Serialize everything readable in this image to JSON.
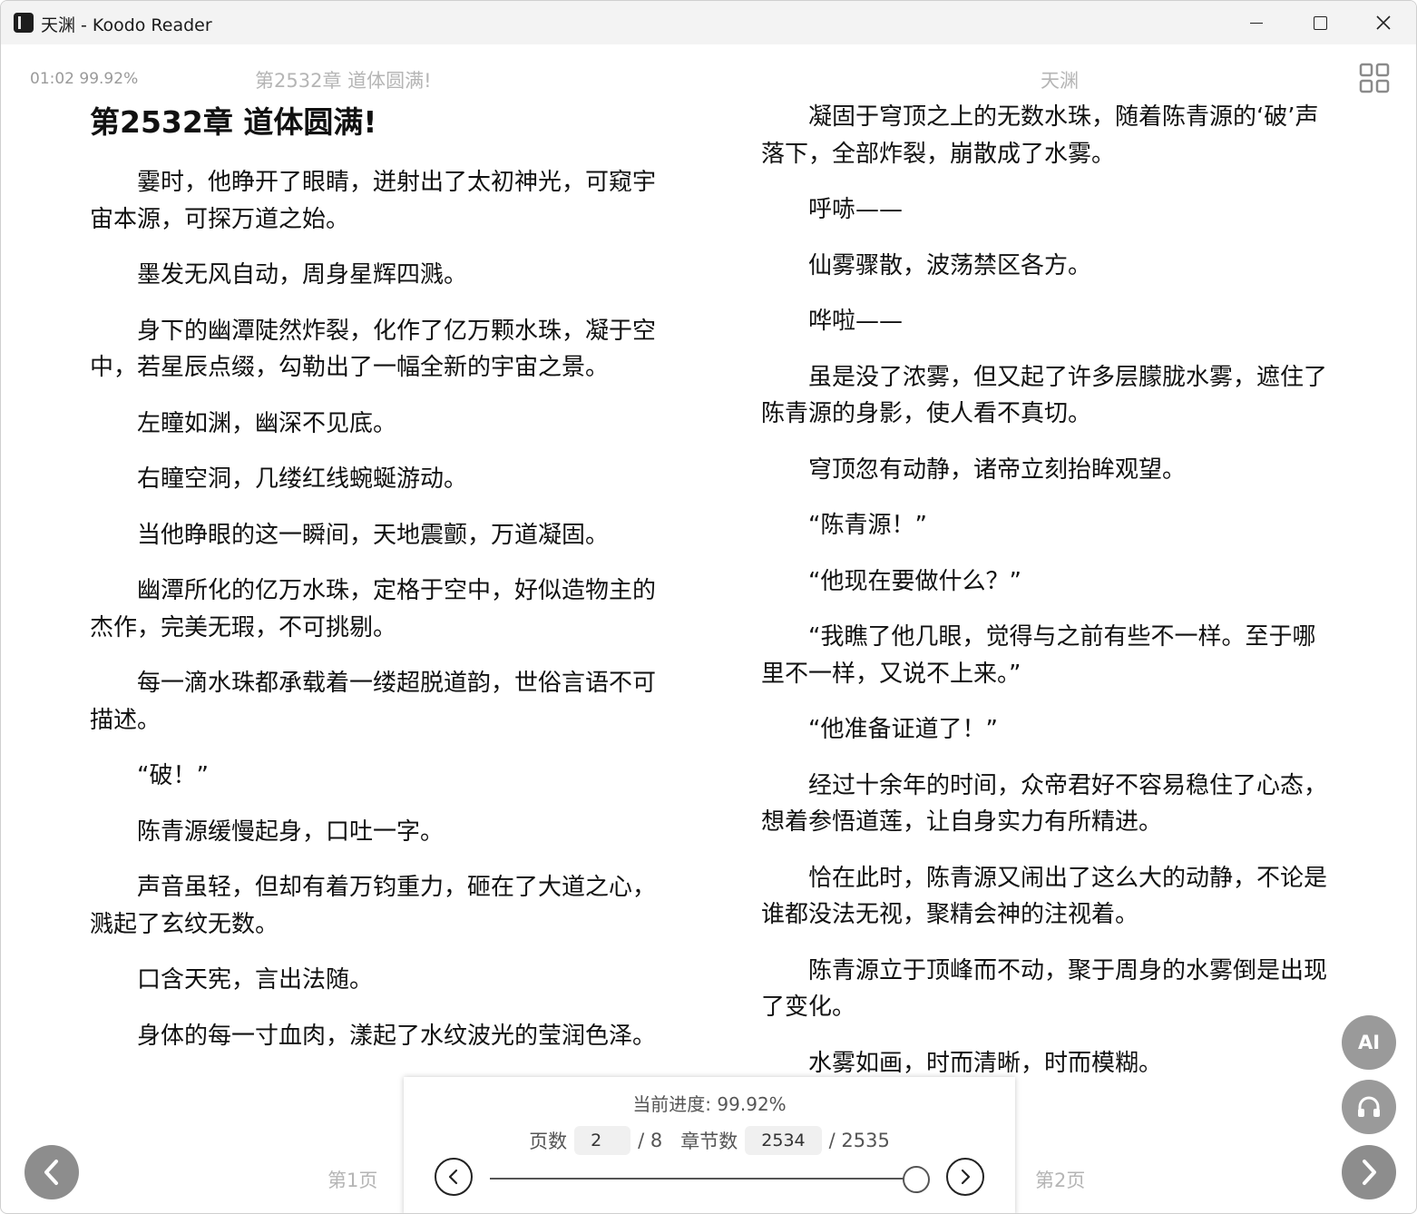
{
  "window": {
    "title": "天渊 - Koodo Reader",
    "controls": [
      "minimize",
      "maximize",
      "close"
    ]
  },
  "header": {
    "time_progress": "01:02 99.92%",
    "left_chapter": "第2532章 道体圆满!",
    "right_book_title": "天渊",
    "grid_icon": "grid-icon"
  },
  "left_page": {
    "chapter_title": "第2532章 道体圆满!",
    "paragraphs": [
      "霎时，他睁开了眼睛，迸射出了太初神光，可窥宇宙本源，可探万道之始。",
      "墨发无风自动，周身星辉四溅。",
      "身下的幽潭陡然炸裂，化作了亿万颗水珠，凝于空中，若星辰点缀，勾勒出了一幅全新的宇宙之景。",
      "左瞳如渊，幽深不见底。",
      "右瞳空洞，几缕红线蜿蜒游动。",
      "当他睁眼的这一瞬间，天地震颤，万道凝固。",
      "幽潭所化的亿万水珠，定格于空中，好似造物主的杰作，完美无瑕，不可挑剔。",
      "每一滴水珠都承载着一缕超脱道韵，世俗言语不可描述。",
      "“破！”",
      "陈青源缓慢起身，口吐一字。",
      "声音虽轻，但却有着万钧重力，砸在了大道之心，溅起了玄纹无数。",
      "口含天宪，言出法随。",
      "身体的每一寸血肉，漾起了水纹波光的莹润色泽。"
    ],
    "page_label": "第1页"
  },
  "right_page": {
    "paragraphs": [
      "凝固于穹顶之上的无数水珠，随着陈青源的‘破’声落下，全部炸裂，崩散成了水雾。",
      "呼哧——",
      "仙雾骤散，波荡禁区各方。",
      "哗啦——",
      "虽是没了浓雾，但又起了许多层朦胧水雾，遮住了陈青源的身影，使人看不真切。",
      "穹顶忽有动静，诸帝立刻抬眸观望。",
      "“陈青源！”",
      "“他现在要做什么？”",
      "“我瞧了他几眼，觉得与之前有些不一样。至于哪里不一样，又说不上来。”",
      "“他准备证道了！”",
      "经过十余年的时间，众帝君好不容易稳住了心态，想着参悟道莲，让自身实力有所精进。",
      "恰在此时，陈青源又闹出了这么大的动静，不论是谁都没法无视，聚精会神的注视着。",
      "陈青源立于顶峰而不动，聚于周身的水雾倒是出现了变化。",
      "水雾如画，时而清晰，时而模糊。"
    ],
    "page_label": "第2页"
  },
  "progress_panel": {
    "current_progress_label": "当前进度: 99.92%",
    "page_label": "页数",
    "page_value": "2",
    "page_total": "/ 8",
    "chapter_label": "章节数",
    "chapter_value": "2534",
    "chapter_total": "/ 2535",
    "slider_fraction": 0.9992
  },
  "side_buttons": {
    "ai_label": "AI",
    "audio_icon": "headphones-icon"
  },
  "nav": {
    "prev_icon": "chevron-left-icon",
    "next_icon": "chevron-right-icon"
  }
}
